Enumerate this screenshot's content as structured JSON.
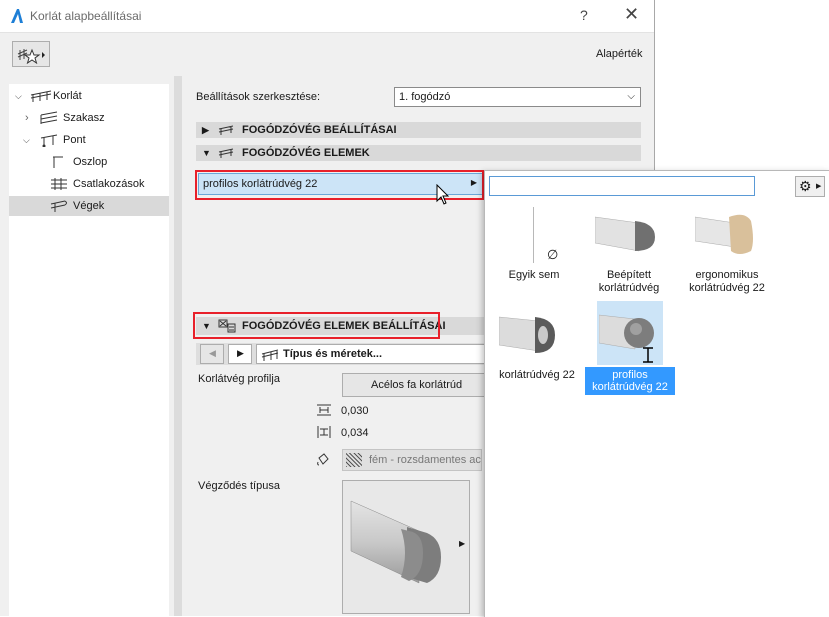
{
  "window": {
    "title": "Korlát alapbeállításai",
    "help": "?",
    "close": "✕"
  },
  "toolbar": {
    "default_label": "Alapérték"
  },
  "tree": [
    {
      "label": "Korlát"
    },
    {
      "label": "Szakasz"
    },
    {
      "label": "Pont"
    },
    {
      "label": "Oszlop"
    },
    {
      "label": "Csatlakozások"
    },
    {
      "label": "Végek"
    }
  ],
  "settings_edit": {
    "label": "Beállítások szerkesztése:",
    "value": "1. fogódzó"
  },
  "sections": {
    "end_settings": "FOGÓDZÓVÉG BEÁLLÍTÁSAI",
    "end_elements": "FOGÓDZÓVÉG ELEMEK",
    "element_settings": "FOGÓDZÓVÉG ELEMEK BEÁLLÍTÁSAI"
  },
  "selected_element": "profilos korlátrúdvég 22",
  "nav": {
    "type_sizes": "Típus és méretek..."
  },
  "properties": {
    "profile_label": "Korlátvég profilja",
    "profile_value": "Acélos fa korlátrúd",
    "value1": "0,030",
    "value2": "0,034",
    "material": "fém - rozsdamentes ac",
    "end_type_label": "Végződés típusa"
  },
  "popup": {
    "search_value": "",
    "items": [
      {
        "line1": "Egyik sem",
        "line2": ""
      },
      {
        "line1": "Beépített",
        "line2": "korlátrúdvég"
      },
      {
        "line1": "ergonomikus",
        "line2": "korlátrúdvég 22"
      },
      {
        "line1": "korlátrúdvég 22",
        "line2": ""
      },
      {
        "line1": "profilos",
        "line2": "korlátrúdvég 22"
      }
    ],
    "none_symbol": "∅"
  },
  "colors": {
    "selection": "#cce4f7",
    "highlight_border": "#e8202a",
    "selected_label_bg": "#3399ff"
  }
}
